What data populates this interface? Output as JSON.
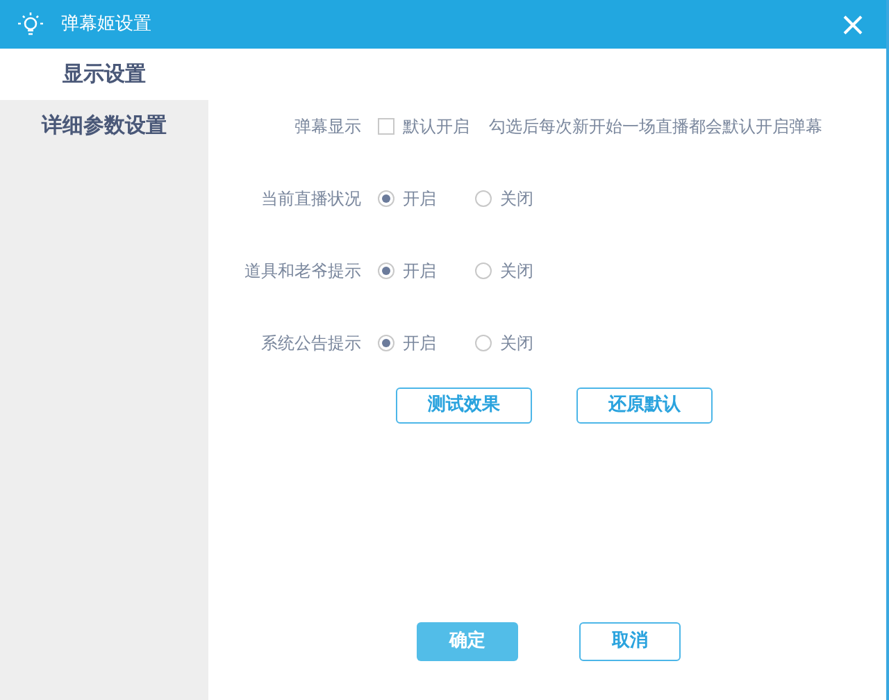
{
  "window": {
    "title": "弹幕姬设置"
  },
  "sidebar": {
    "items": [
      {
        "label": "显示设置",
        "selected": true
      },
      {
        "label": "详细参数设置",
        "selected": false
      }
    ]
  },
  "settings": [
    {
      "kind": "checkbox",
      "label": "弹幕显示",
      "option": "默认开启",
      "checked": false,
      "hint": "勾选后每次新开始一场直播都会默认开启弹幕"
    },
    {
      "kind": "radio",
      "label": "当前直播状况",
      "options": [
        {
          "label": "开启",
          "selected": true
        },
        {
          "label": "关闭",
          "selected": false
        }
      ]
    },
    {
      "kind": "radio",
      "label": "道具和老爷提示",
      "options": [
        {
          "label": "开启",
          "selected": true
        },
        {
          "label": "关闭",
          "selected": false
        }
      ]
    },
    {
      "kind": "radio",
      "label": "系统公告提示",
      "options": [
        {
          "label": "开启",
          "selected": true
        },
        {
          "label": "关闭",
          "selected": false
        }
      ]
    }
  ],
  "actions": [
    "测试效果",
    "还原默认"
  ],
  "footer": {
    "confirm": "确定",
    "cancel": "取消"
  }
}
